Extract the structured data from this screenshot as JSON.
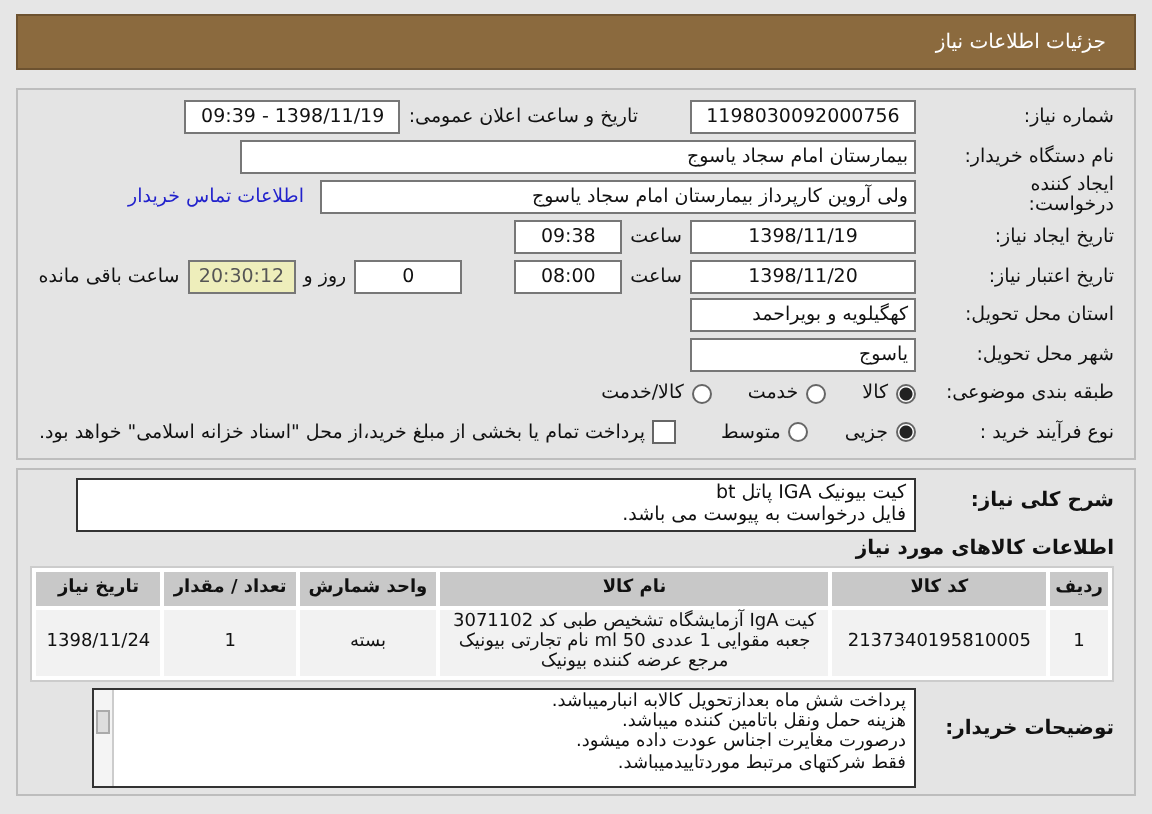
{
  "header": {
    "title": "جزئیات اطلاعات نیاز"
  },
  "need_number": {
    "label": "شماره نیاز:",
    "value": "1198030092000756"
  },
  "announce": {
    "label": "تاریخ و ساعت اعلان عمومی:",
    "value": "1398/11/19 - 09:39"
  },
  "buyer_org": {
    "label": "نام دستگاه خریدار:",
    "value": "بیمارستان امام سجاد یاسوج"
  },
  "requester": {
    "label": "ایجاد کننده درخواست:",
    "value": "ولی آروین کارپرداز بیمارستان امام سجاد یاسوج",
    "contact_link": "اطلاعات تماس خریدار"
  },
  "created": {
    "label": "تاریخ ایجاد نیاز:",
    "date": "1398/11/19",
    "time_label": "ساعت",
    "time": "09:38"
  },
  "validity": {
    "label": "تاریخ اعتبار نیاز:",
    "date": "1398/11/20",
    "time_label": "ساعت",
    "time": "08:00",
    "days": "0",
    "days_label": "روز و",
    "remaining": "20:30:12",
    "remaining_label": "ساعت باقی مانده"
  },
  "province": {
    "label": "استان محل تحویل:",
    "value": "کهگیلویه و بویراحمد"
  },
  "city": {
    "label": "شهر محل تحویل:",
    "value": "یاسوج"
  },
  "category": {
    "label": "طبقه بندی موضوعی:",
    "options": [
      {
        "label": "کالا",
        "selected": true
      },
      {
        "label": "خدمت",
        "selected": false
      },
      {
        "label": "کالا/خدمت",
        "selected": false
      }
    ]
  },
  "process": {
    "label": "نوع فرآیند خرید :",
    "options": [
      {
        "label": "جزیی",
        "selected": true
      },
      {
        "label": "متوسط",
        "selected": false
      }
    ],
    "payment": {
      "label": "پرداخت تمام یا بخشی از مبلغ خرید،از محل \"اسناد خزانه اسلامی\" خواهد بود.",
      "checked": false
    }
  },
  "description": {
    "label": "شرح کلی نیاز:",
    "lines": [
      "کیت بیونیک IGA پاتل bt",
      "فایل درخواست به پیوست می باشد."
    ]
  },
  "goods_title": "اطلاعات کالاهای مورد نیاز",
  "table": {
    "columns": [
      "ردیف",
      "کد کالا",
      "نام کالا",
      "واحد شمارش",
      "تعداد / مقدار",
      "تاریخ نیاز"
    ],
    "rows": [
      [
        "1",
        "2137340195810005",
        "کیت IgA آزمایشگاه تشخیص طبی کد 3071102 جعبه مقوایی 1 عددی ml 50 نام تجارتی بیونیک مرجع عرضه کننده بیونیک",
        "بسته",
        "1",
        "1398/11/24"
      ]
    ]
  },
  "buyer_notes": {
    "label": "توضیحات خریدار:",
    "lines": [
      "پرداخت شش ماه بعدازتحویل کالابه انبارمیباشد.",
      "هزینه حمل ونقل باتامین کننده میباشد.",
      "درصورت مغایرت اجناس عودت داده میشود.",
      "فقط شرکتهای مرتبط موردتاییدمیباشد."
    ]
  }
}
